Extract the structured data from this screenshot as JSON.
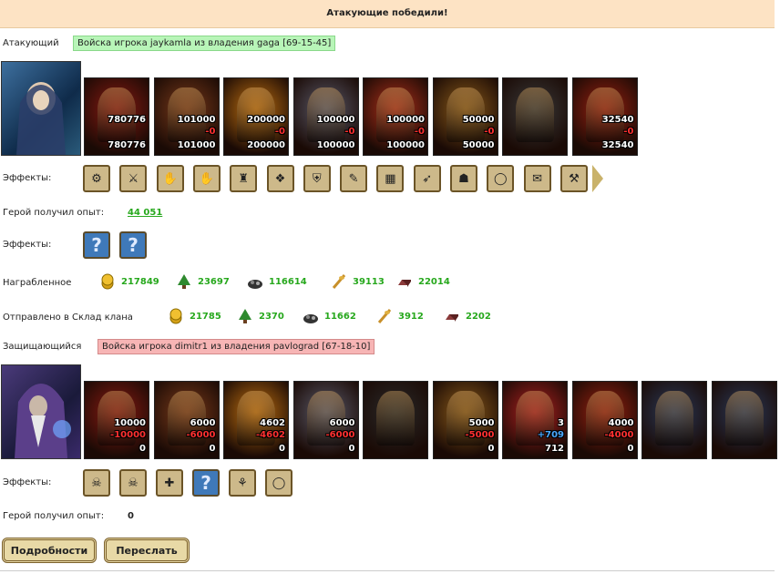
{
  "banner": "Атакующие победили!",
  "attacker": {
    "label": "Атакующий",
    "tag": "Войска игрока jaykamla из владения gaga [69-15-45]",
    "units": [
      {
        "n1": "780776",
        "n2": "",
        "n3": "780776",
        "color": "#8a1a12"
      },
      {
        "n1": "101000",
        "n2": "-0",
        "n3": "101000",
        "color": "#7a3a1a"
      },
      {
        "n1": "200000",
        "n2": "-0",
        "n3": "200000",
        "color": "#c07010"
      },
      {
        "n1": "100000",
        "n2": "-0",
        "n3": "100000",
        "color": "#5a5a6a"
      },
      {
        "n1": "100000",
        "n2": "-0",
        "n3": "100000",
        "color": "#b0301a"
      },
      {
        "n1": "50000",
        "n2": "-0",
        "n3": "50000",
        "color": "#8a5a1a"
      },
      {
        "n1": "",
        "n2": "",
        "n3": "",
        "color": "#3a3a3a"
      },
      {
        "n1": "32540",
        "n2": "-0",
        "n3": "32540",
        "color": "#9a2010"
      }
    ],
    "effects_label": "Эффекты:",
    "effects": [
      "⚙",
      "⚔",
      "✋",
      "✋",
      "♜",
      "❖",
      "⛨",
      "✎",
      "▦",
      "➶",
      "☗",
      "◯",
      "✉",
      "⚒"
    ],
    "xp_label": "Герой получил опыт:",
    "xp_value": "44 051",
    "effects2_label": "Эффекты:",
    "effects2": [
      "?",
      "?"
    ],
    "loot_label": "Награбленное",
    "loot": [
      "217849",
      "23697",
      "116614",
      "39113",
      "22014"
    ],
    "clan_label": "Отправлено в Склад клана",
    "clan": [
      "21785",
      "2370",
      "11662",
      "3912",
      "2202"
    ]
  },
  "defender": {
    "label": "Защищающийся",
    "tag": "Войска игрока dimitr1 из владения pavlograd [67-18-10]",
    "units": [
      {
        "n1": "10000",
        "n2": "-10000",
        "n3": "0",
        "color": "#8a1a12"
      },
      {
        "n1": "6000",
        "n2": "-6000",
        "n3": "0",
        "color": "#7a3a1a"
      },
      {
        "n1": "4602",
        "n2": "-4602",
        "n3": "0",
        "color": "#c07010"
      },
      {
        "n1": "6000",
        "n2": "-6000",
        "n3": "0",
        "color": "#5a5a6a"
      },
      {
        "n1": "",
        "n2": "",
        "n3": "",
        "color": "#2a2a2a"
      },
      {
        "n1": "5000",
        "n2": "-5000",
        "n3": "0",
        "color": "#8a5a1a"
      },
      {
        "n1": "3",
        "n2": "+709",
        "n3": "712",
        "color": "#b02020"
      },
      {
        "n1": "4000",
        "n2": "-4000",
        "n3": "0",
        "color": "#9a2010"
      },
      {
        "n1": "",
        "n2": "",
        "n3": "",
        "color": "#2a3a5a"
      },
      {
        "n1": "",
        "n2": "",
        "n3": "",
        "color": "#2a3a5a"
      }
    ],
    "effects_label": "Эффекты:",
    "effects": [
      "☠",
      "☠",
      "✚",
      "?",
      "⚘",
      "◯"
    ],
    "xp_label": "Герой получил опыт:",
    "xp_value": "0"
  },
  "buttons": {
    "details": "Подробности",
    "forward": "Переслать"
  },
  "colors": {
    "gold": "#d4a017",
    "wood": "#2f8a2f",
    "ore": "#333333",
    "grain": "#c8902a",
    "iron": "#8b3a3a",
    "green": "#27a81d"
  }
}
